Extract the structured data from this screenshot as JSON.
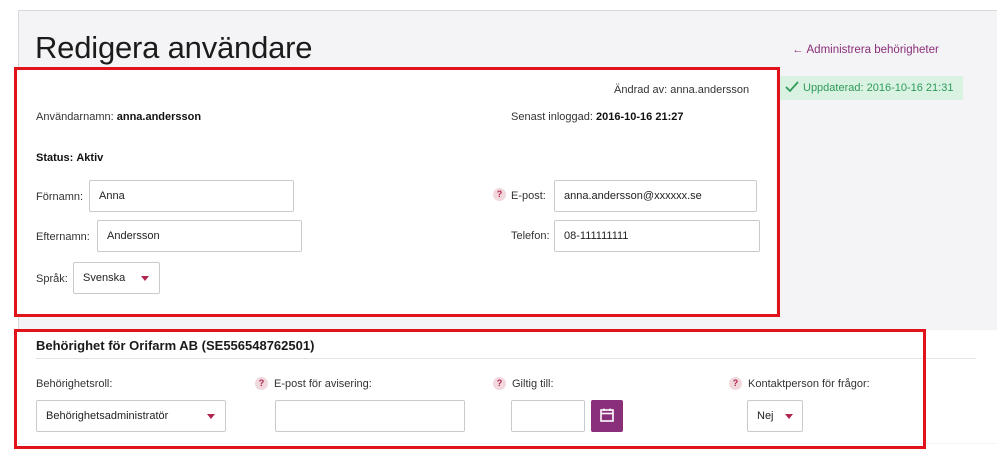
{
  "page": {
    "title": "Redigera användare",
    "admin_link": "Administrera behörigheter",
    "admin_link_arrow": "←"
  },
  "toast": {
    "text": "Uppdaterad: 2016-10-16 21:31",
    "icon": "checkmark-icon"
  },
  "user": {
    "changed_by_label": "Ändrad av:",
    "changed_by_value": "anna.andersson",
    "username_label": "Användarnamn:",
    "username_value": "anna.andersson",
    "last_login_label": "Senast inloggad:",
    "last_login_value": "2016-10-16 21:27",
    "status_label": "Status:",
    "status_value": "Aktiv",
    "firstname_label": "Förnamn:",
    "firstname_value": "Anna",
    "lastname_label": "Efternamn:",
    "lastname_value": "Andersson",
    "language_label": "Språk:",
    "language_value": "Svenska",
    "email_label": "E-post:",
    "email_value": "anna.andersson@xxxxxx.se",
    "phone_label": "Telefon:",
    "phone_value": "08-111111111",
    "help_icon_text": "?"
  },
  "permissions": {
    "title": "Behörighet för Orifarm AB (SE556548762501)",
    "role_label": "Behörighetsroll:",
    "role_value": "Behörighetsadministratör",
    "notify_email_label": "E-post för avisering:",
    "notify_email_value": "",
    "valid_until_label": "Giltig till:",
    "valid_until_value": "",
    "contact_label": "Kontaktperson för frågor:",
    "contact_value": "Nej",
    "help_icon_text": "?"
  },
  "colors": {
    "accent": "#8a2f7a",
    "highlight_border": "#e0131a",
    "success_bg": "#d9f2e2",
    "success_text": "#2f9a58"
  }
}
